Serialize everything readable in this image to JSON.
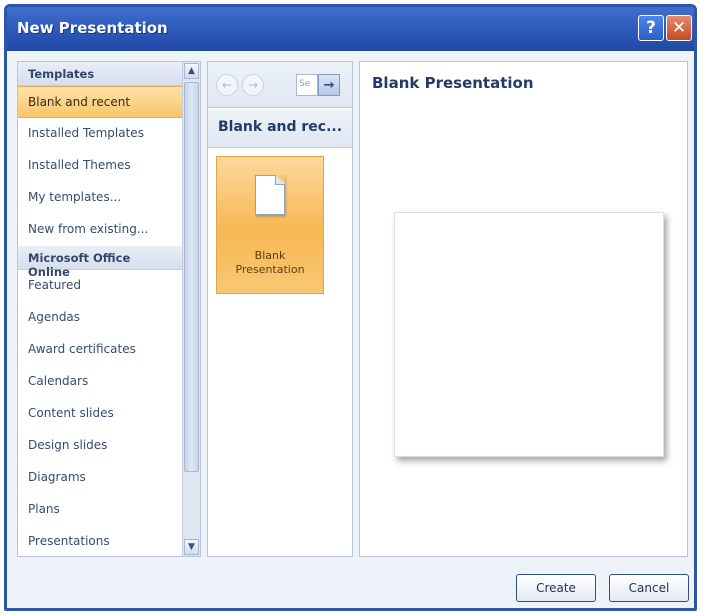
{
  "window": {
    "title": "New Presentation",
    "help_label": "?",
    "close_label": "✕"
  },
  "sidebar": {
    "header_templates": "Templates",
    "items_top": [
      {
        "label": "Blank and recent",
        "selected": true
      },
      {
        "label": "Installed Templates"
      },
      {
        "label": "Installed Themes"
      },
      {
        "label": "My templates..."
      },
      {
        "label": "New from existing..."
      }
    ],
    "header_online": "Microsoft Office Online",
    "items_online": [
      {
        "label": "Featured"
      },
      {
        "label": "Agendas"
      },
      {
        "label": "Award certificates"
      },
      {
        "label": "Calendars"
      },
      {
        "label": "Content slides"
      },
      {
        "label": "Design slides"
      },
      {
        "label": "Diagrams"
      },
      {
        "label": "Plans"
      },
      {
        "label": "Presentations"
      }
    ]
  },
  "middle": {
    "back_icon": "←",
    "forward_icon": "→",
    "search_placeholder": "Se",
    "search_go_icon": "→",
    "header": "Blank and rec...",
    "tiles": [
      {
        "label": "Blank Presentation",
        "icon": "blank-document-icon",
        "selected": true
      }
    ]
  },
  "preview": {
    "title": "Blank Presentation"
  },
  "footer": {
    "create_label": "Create",
    "cancel_label": "Cancel"
  },
  "colors": {
    "titlebar": "#2b57b8",
    "selection": "#f9c66a",
    "accent_text": "#233c66"
  }
}
